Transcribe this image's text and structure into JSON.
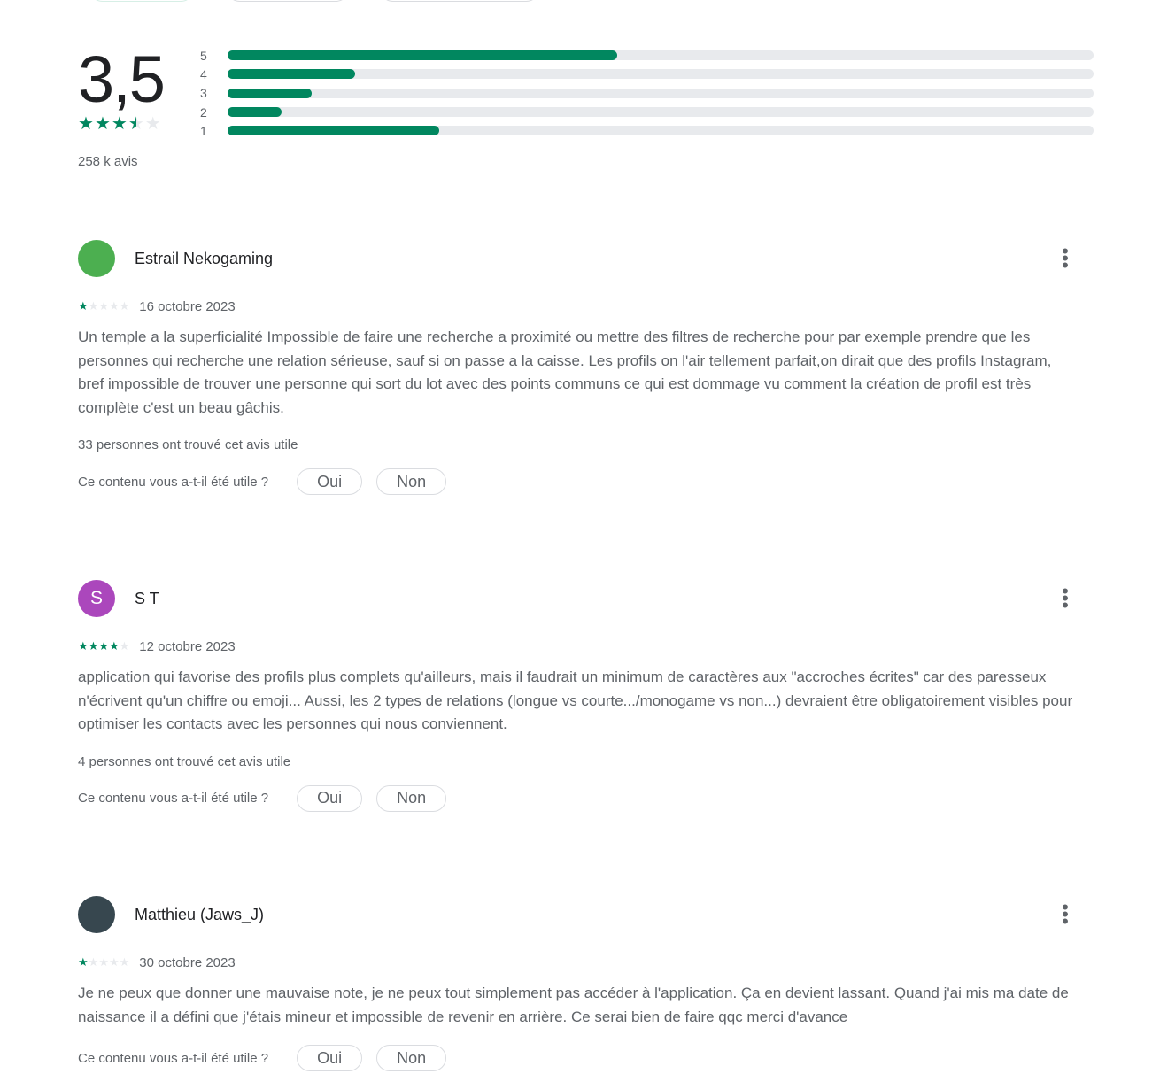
{
  "summary": {
    "rating": "3,5",
    "stars": 3.5,
    "count": "258 k avis",
    "distribution": [
      {
        "label": "5",
        "fraction": 0.45
      },
      {
        "label": "4",
        "fraction": 0.147
      },
      {
        "label": "3",
        "fraction": 0.097
      },
      {
        "label": "2",
        "fraction": 0.062
      },
      {
        "label": "1",
        "fraction": 0.244
      }
    ]
  },
  "colors": {
    "accent": "#01875f",
    "track": "#e8eaed"
  },
  "reviews": [
    {
      "name": "Estrail Nekogaming",
      "avatar_letter": "",
      "avatar_color": "#4caf50",
      "stars": 1,
      "date": "16 octobre 2023",
      "text": "Un temple a la superficialité Impossible de faire une recherche a proximité ou mettre des filtres de recherche pour par exemple prendre que les personnes qui recherche une relation sérieuse, sauf si on passe a la caisse. Les profils on l'air tellement parfait,on dirait que des profils Instagram, bref impossible de trouver une personne qui sort du lot avec des points communs ce qui est dommage vu comment la création de profil est très complète c'est un beau gâchis.",
      "helpful": "33 personnes ont trouvé cet avis utile",
      "question": "Ce contenu vous a-t-il été utile ?",
      "yes": "Oui",
      "no": "Non"
    },
    {
      "name": "S T",
      "avatar_letter": "S",
      "avatar_color": "#ab47bc",
      "stars": 4,
      "date": "12 octobre 2023",
      "text": "application qui favorise des profils plus complets qu'ailleurs, mais il faudrait un minimum de caractères aux \"accroches écrites\" car des paresseux n'écrivent qu'un chiffre ou emoji... Aussi, les 2 types de relations (longue vs courte.../monogame vs non...) devraient être obligatoirement visibles pour optimiser les contacts avec les personnes qui nous conviennent.",
      "helpful": "4 personnes ont trouvé cet avis utile",
      "question": "Ce contenu vous a-t-il été utile ?",
      "yes": "Oui",
      "no": "Non"
    },
    {
      "name": "Matthieu (Jaws_J)",
      "avatar_letter": "",
      "avatar_color": "#37474f",
      "stars": 1,
      "date": "30 octobre 2023",
      "text": "Je ne peux que donner une mauvaise note, je ne peux tout simplement pas accéder à l'application. Ça en devient lassant. Quand j'ai mis ma date de naissance il a défini que j'étais mineur et impossible de revenir en arrière. Ce serai bien de faire qqc merci d'avance",
      "helpful": "",
      "question": "Ce contenu vous a-t-il été utile ?",
      "yes": "Oui",
      "no": "Non"
    }
  ]
}
